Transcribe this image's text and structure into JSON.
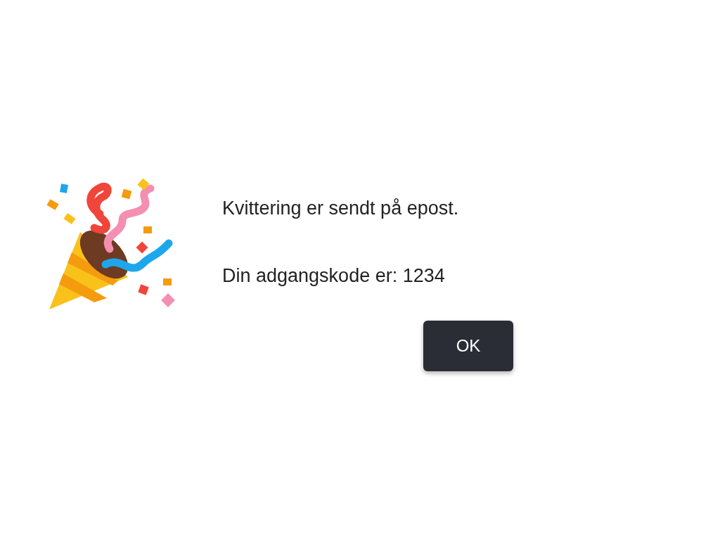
{
  "dialog": {
    "message": "Kvittering er sendt på epost.",
    "code_line": "Din adgangskode er: 1234",
    "button": "OK"
  }
}
